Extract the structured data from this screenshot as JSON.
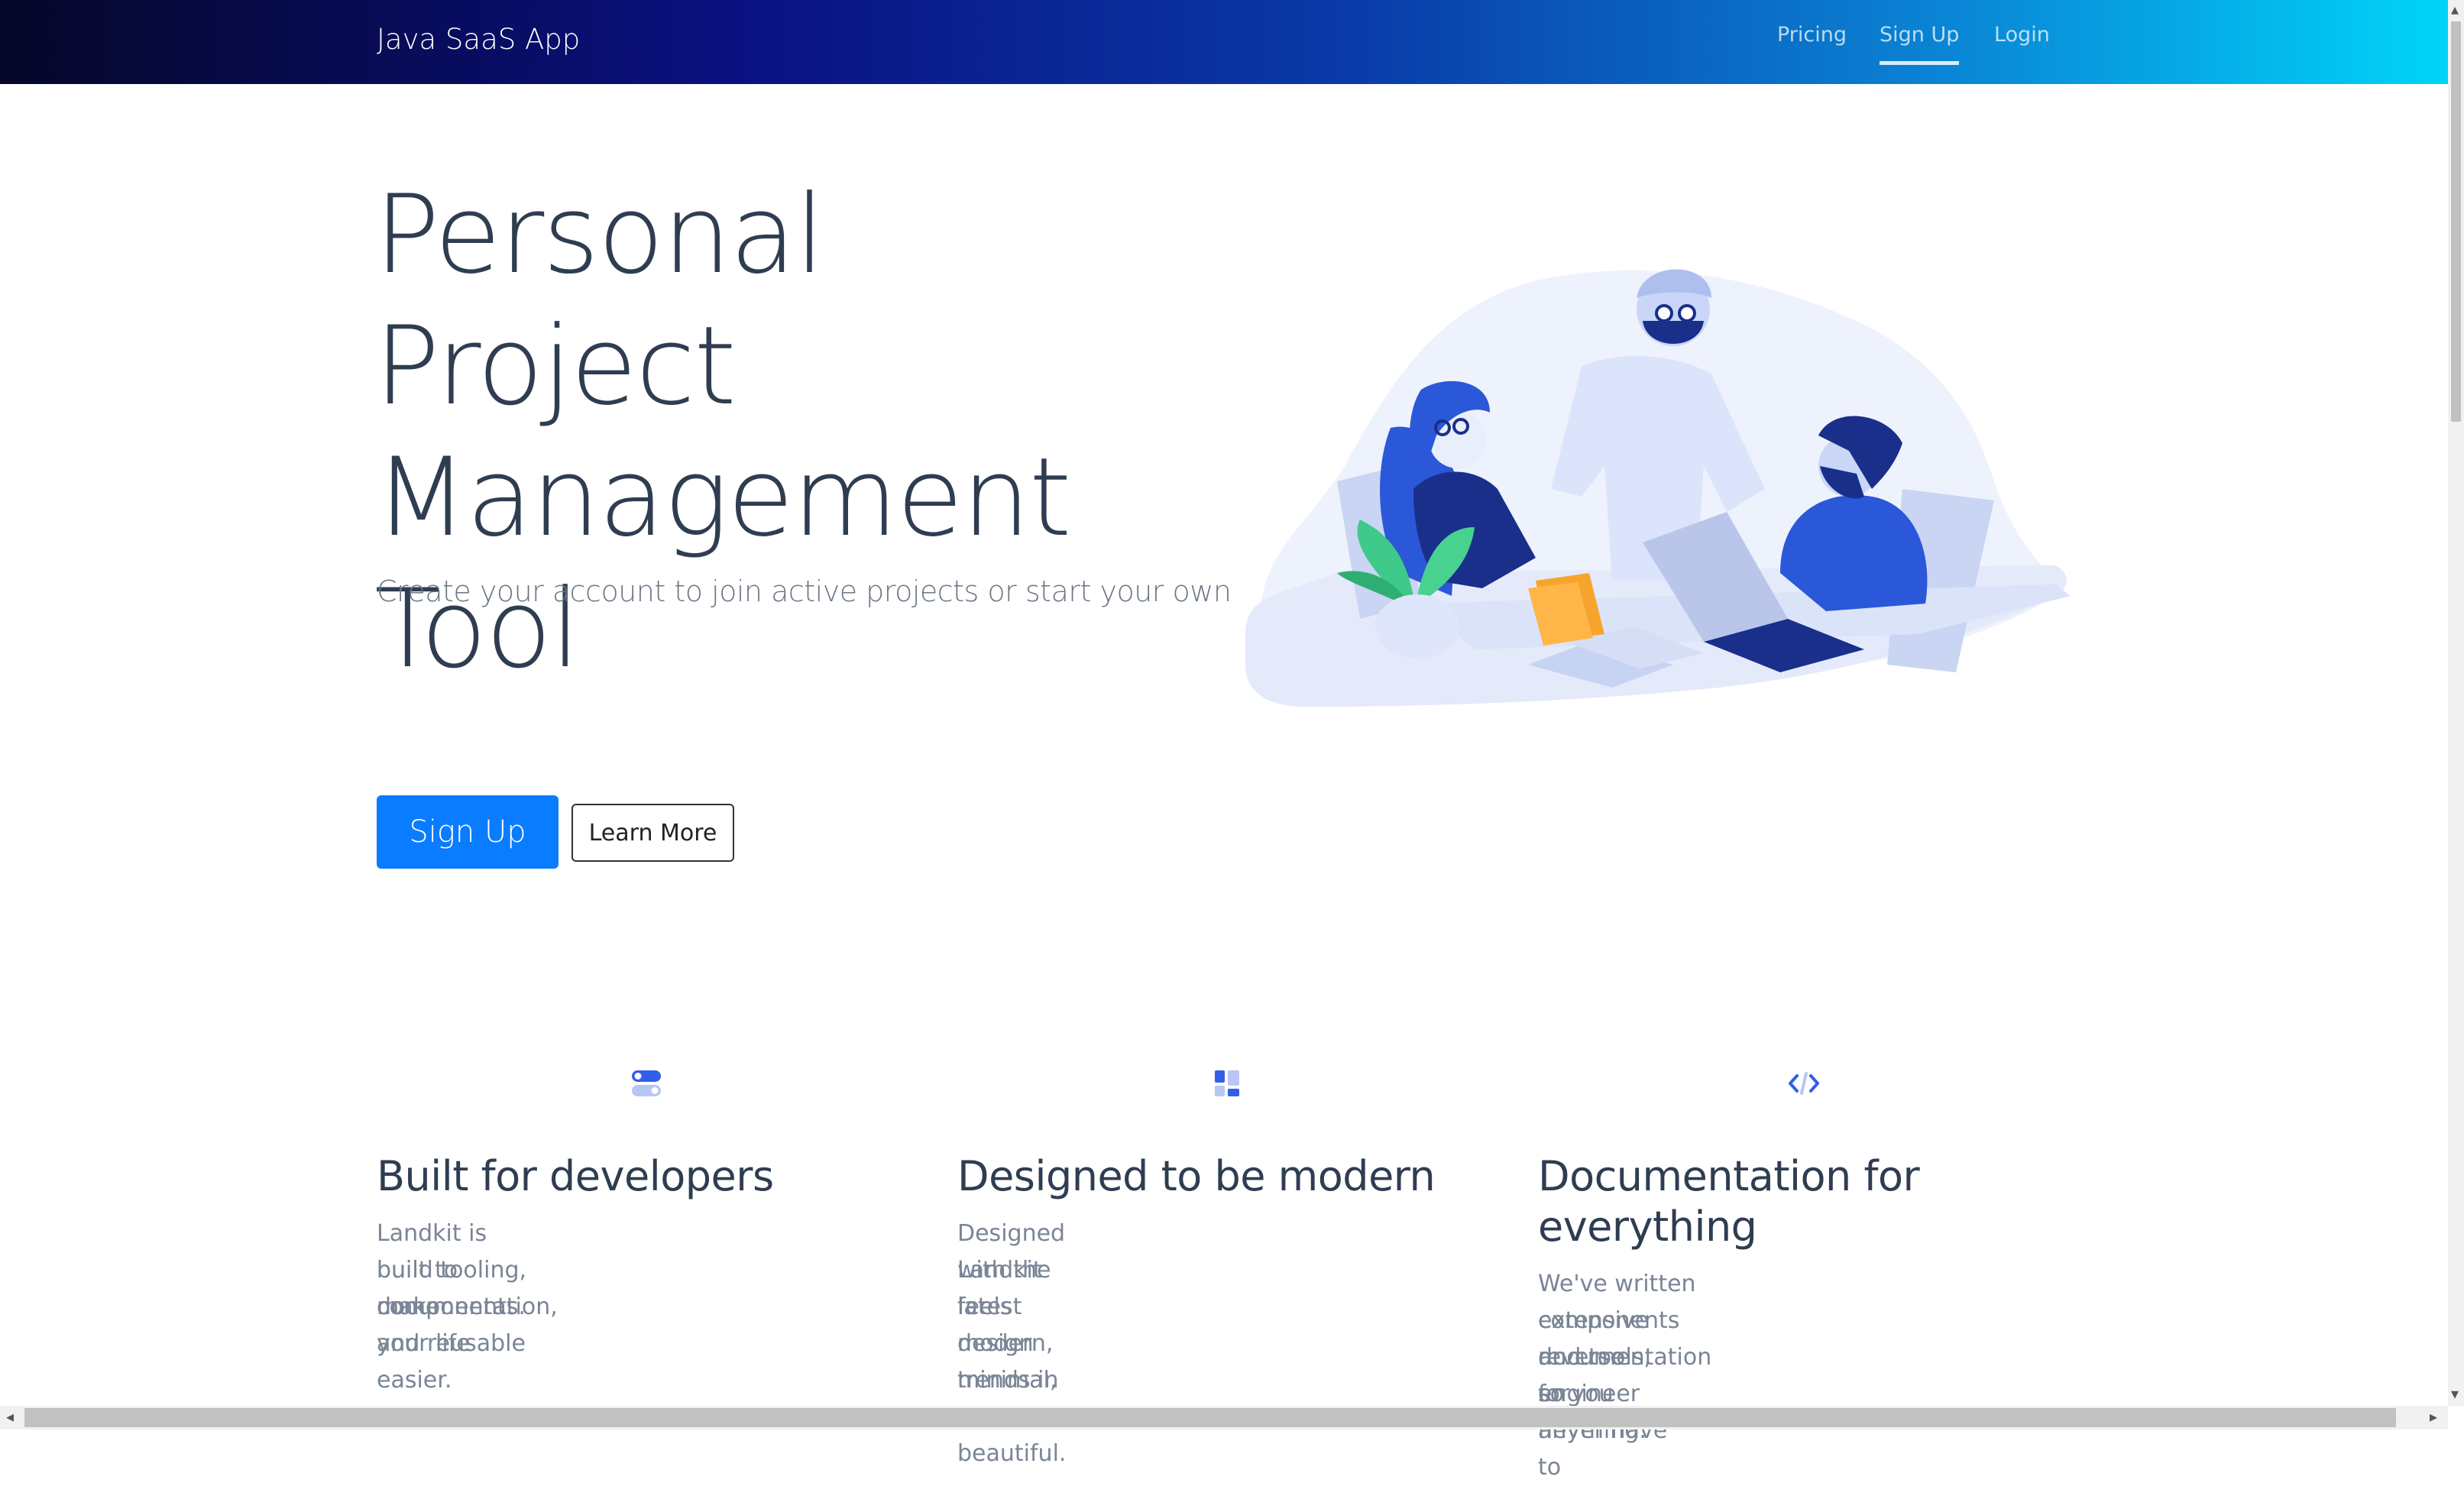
{
  "navbar": {
    "brand": "Java SaaS App",
    "links": [
      {
        "label": "Pricing",
        "active": false
      },
      {
        "label": "Sign Up",
        "active": true
      },
      {
        "label": "Login",
        "active": false
      }
    ]
  },
  "hero": {
    "title_lines": [
      "Personal Project",
      "Management",
      "Tool"
    ],
    "subtitle": "Create your account to join active projects or start your own",
    "primary_button": "Sign Up",
    "secondary_button": "Learn More"
  },
  "features": [
    {
      "icon": "toggle-icon",
      "title": "Built for developers",
      "text_lines": [
        "Landkit is built to make your life easier. Variables,",
        "build tooling, documentation, and reusable",
        "components."
      ]
    },
    {
      "icon": "layout-icon",
      "title": "Designed to be modern",
      "text_lines": [
        "Designed with the latest design trends in mind.",
        "Landkit feels modern, minimal, and beautiful."
      ]
    },
    {
      "icon": "code-icon",
      "title_lines": [
        "Documentation for",
        "everything"
      ],
      "text_lines": [
        "We've written extensive documentation for",
        "components and tools, so you never have to",
        "reverse engineer anything."
      ]
    }
  ],
  "colors": {
    "primary": "#0a7cff",
    "heading": "#2f3d51",
    "muted": "#7a8596",
    "icon_accent": "#335eea"
  }
}
